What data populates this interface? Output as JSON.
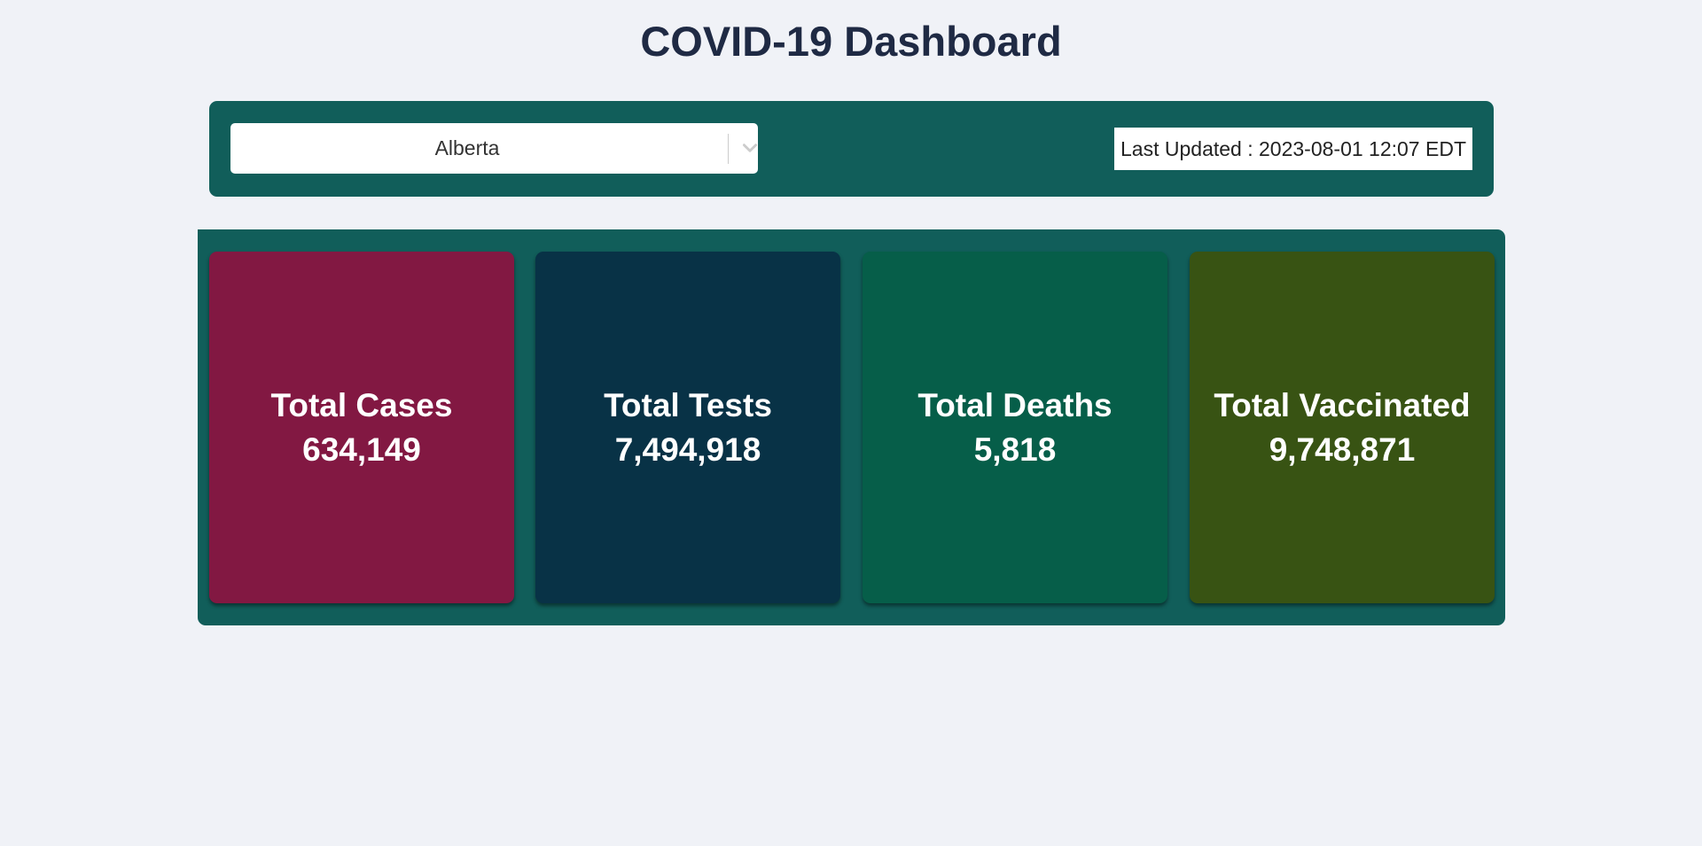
{
  "header": {
    "title": "COVID-19 Dashboard"
  },
  "controls": {
    "region_selected": "Alberta",
    "dropdown_icon": "chevron-down-icon",
    "last_updated": "Last Updated : 2023-08-01 12:07 EDT"
  },
  "stats": [
    {
      "label": "Total Cases",
      "value": "634,149",
      "color": "#821842"
    },
    {
      "label": "Total Tests",
      "value": "7,494,918",
      "color": "#083246"
    },
    {
      "label": "Total Deaths",
      "value": "5,818",
      "color": "#065e49"
    },
    {
      "label": "Total Vaccinated",
      "value": "9,748,871",
      "color": "#385313"
    }
  ],
  "theme": {
    "background": "#f0f2f7",
    "panel": "#115e5a",
    "title_color": "#1f2a44"
  }
}
